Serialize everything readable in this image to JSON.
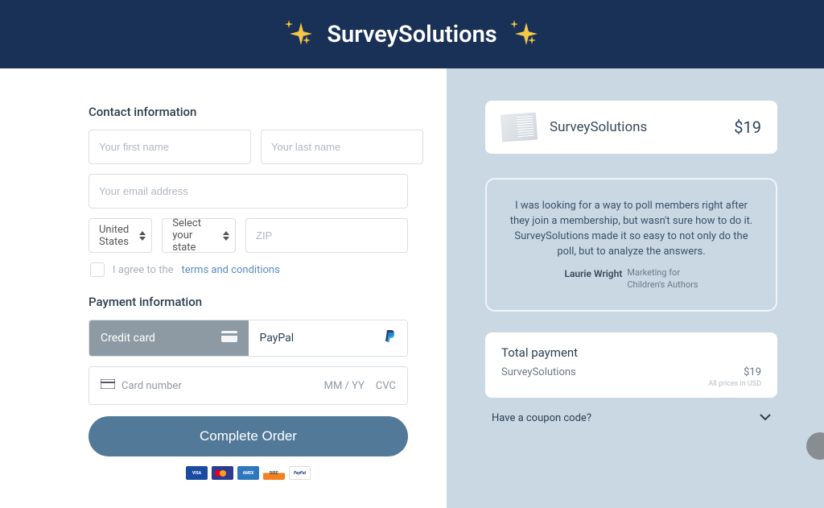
{
  "header": {
    "title": "SurveySolutions"
  },
  "left": {
    "contact": {
      "title": "Contact information",
      "first_name_placeholder": "Your first name",
      "last_name_placeholder": "Your last name",
      "email_placeholder": "Your email address",
      "country_selected": "United States",
      "state_placeholder": "Select your state",
      "zip_placeholder": "ZIP",
      "agree_prefix": "I agree to the ",
      "agree_link": "terms and conditions"
    },
    "payment": {
      "title": "Payment information",
      "tab_card": "Credit card",
      "tab_paypal": "PayPal",
      "card_number_placeholder": "Card number",
      "mmyy": "MM / YY",
      "cvc": "CVC"
    },
    "submit_label": "Complete Order",
    "logos": {
      "visa": "VISA",
      "amex": "AMEX",
      "disc": "DISC",
      "paypal": "PayPal"
    }
  },
  "right": {
    "product": {
      "name": "SurveySolutions",
      "price": "$19"
    },
    "testimonial": {
      "text": "I was looking for a way to poll members right after they join a membership, but wasn't sure how to do it. SurveySolutions made it so easy to not only do the poll, but to analyze the answers.",
      "author": "Laurie Wright",
      "org_line1": "Marketing for",
      "org_line2": "Children's Authors"
    },
    "total": {
      "title": "Total payment",
      "line_name": "SurveySolutions",
      "line_price": "$19",
      "note": "All prices in USD"
    },
    "coupon_label": "Have a coupon code?"
  }
}
